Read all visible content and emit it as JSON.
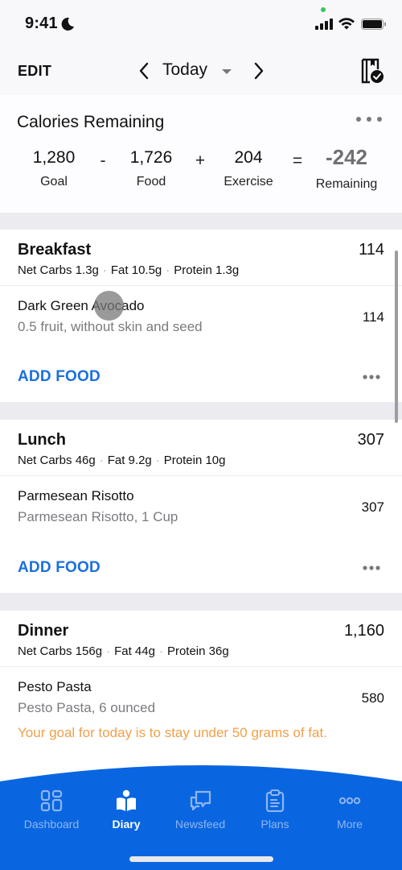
{
  "status_bar": {
    "time": "9:41",
    "icons": [
      "moon-icon",
      "signal-icon",
      "wifi-icon",
      "battery-icon"
    ]
  },
  "header": {
    "edit_label": "EDIT",
    "date_label": "Today",
    "icons": [
      "chevron-left-icon",
      "caret-down-icon",
      "chevron-right-icon",
      "packer-check-icon"
    ]
  },
  "calories": {
    "title": "Calories Remaining",
    "goal": {
      "value": "1,280",
      "label": "Goal"
    },
    "minus": "-",
    "food": {
      "value": "1,726",
      "label": "Food"
    },
    "plus": "+",
    "exercise": {
      "value": "204",
      "label": "Exercise"
    },
    "equals": "=",
    "remaining": {
      "value": "-242",
      "label": "Remaining"
    }
  },
  "meals": [
    {
      "name": "Breakfast",
      "calories": "114",
      "macros": {
        "carbs": "Net Carbs 1.3g",
        "fat": "Fat 10.5g",
        "protein": "Protein 1.3g"
      },
      "items": [
        {
          "name": "Dark Green Avocado",
          "description": "0.5 fruit, without skin and seed",
          "calories": "114"
        }
      ],
      "add_label": "ADD FOOD"
    },
    {
      "name": "Lunch",
      "calories": "307",
      "macros": {
        "carbs": "Net Carbs 46g",
        "fat": "Fat 9.2g",
        "protein": "Protein 10g"
      },
      "items": [
        {
          "name": "Parmesean Risotto",
          "description": "Parmesean Risotto, 1 Cup",
          "calories": "307"
        }
      ],
      "add_label": "ADD FOOD"
    },
    {
      "name": "Dinner",
      "calories": "1,160",
      "macros": {
        "carbs": "Net Carbs 156g",
        "fat": "Fat 44g",
        "protein": "Protein 36g"
      },
      "items": [
        {
          "name": "Pesto Pasta",
          "description": "Pesto Pasta, 6 ounced",
          "calories": "580",
          "note": "Your goal for today is to stay under 50 grams of fat."
        }
      ]
    }
  ],
  "macro_separator": "·",
  "tabs": [
    {
      "label": "Dashboard",
      "icon": "dashboard-icon",
      "active": false
    },
    {
      "label": "Diary",
      "icon": "diary-icon",
      "active": true
    },
    {
      "label": "Newsfeed",
      "icon": "newsfeed-icon",
      "active": false
    },
    {
      "label": "Plans",
      "icon": "plans-icon",
      "active": false
    },
    {
      "label": "More",
      "icon": "more-icon",
      "active": false
    }
  ],
  "colors": {
    "brand_blue": "#0A66E0",
    "add_food_blue": "#1A6FE0",
    "warning_orange": "#F0A04B",
    "remaining_gray": "#707074",
    "tab_inactive": "#8FB6F1"
  }
}
